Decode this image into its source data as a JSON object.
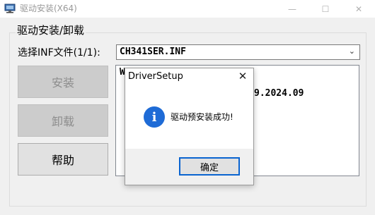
{
  "window": {
    "title": "驱动安装(X64)",
    "controls": {
      "minimize": "—",
      "maximize": "☐",
      "close": "✕"
    }
  },
  "group": {
    "title": "驱动安装/卸载"
  },
  "inf": {
    "label": "选择INF文件(1/1):",
    "value": "CH341SER.INF",
    "arrow": "⌄"
  },
  "buttons": {
    "install": "安装",
    "uninstall": "卸载",
    "help": "帮助"
  },
  "info": {
    "line1": "W",
    "line2": "9.2024.09"
  },
  "dialog": {
    "title": "DriverSetup",
    "close": "✕",
    "icon": "i",
    "message": "驱动预安装成功!",
    "ok": "确定"
  },
  "colors": {
    "accent": "#0a64d0",
    "info_icon": "#1e6bd6",
    "window_bg": "#f0f0f0"
  }
}
